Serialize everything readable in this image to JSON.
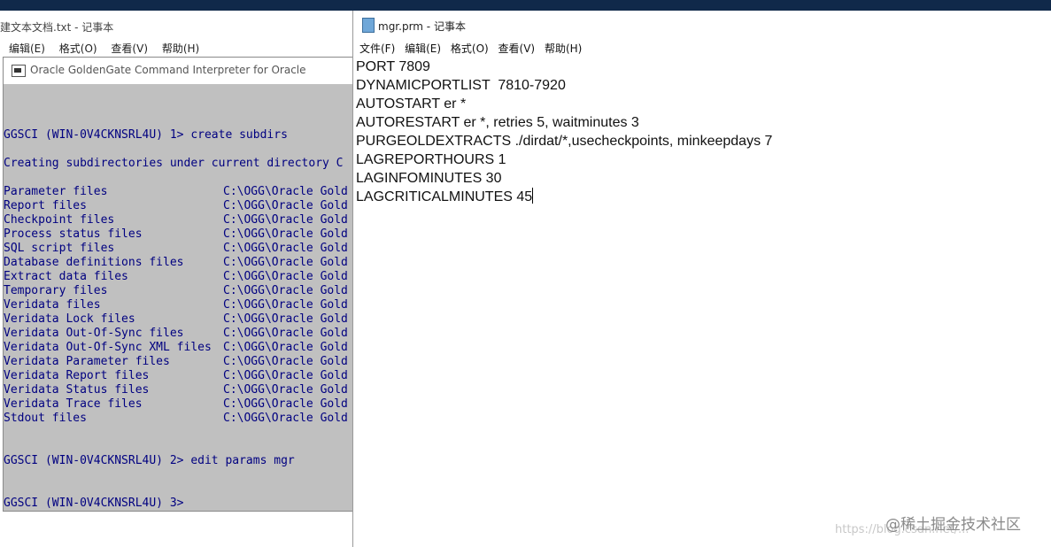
{
  "left_notepad": {
    "title": "建文本文档.txt - 记事本",
    "menu": [
      "编辑(E)",
      "格式(O)",
      "查看(V)",
      "帮助(H)"
    ]
  },
  "console": {
    "title": "Oracle GoldenGate Command Interpreter for Oracle",
    "command1": "GGSCI (WIN-0V4CKNSRL4U) 1> create subdirs",
    "creating": "Creating subdirectories under current directory C",
    "subdirs": [
      {
        "label": "Parameter files",
        "path": "C:\\OGG\\Oracle Gold"
      },
      {
        "label": "Report files",
        "path": "C:\\OGG\\Oracle Gold"
      },
      {
        "label": "Checkpoint files",
        "path": "C:\\OGG\\Oracle Gold"
      },
      {
        "label": "Process status files",
        "path": "C:\\OGG\\Oracle Gold"
      },
      {
        "label": "SQL script files",
        "path": "C:\\OGG\\Oracle Gold"
      },
      {
        "label": "Database definitions files",
        "path": "C:\\OGG\\Oracle Gold"
      },
      {
        "label": "Extract data files",
        "path": "C:\\OGG\\Oracle Gold"
      },
      {
        "label": "Temporary files",
        "path": "C:\\OGG\\Oracle Gold"
      },
      {
        "label": "Veridata files",
        "path": "C:\\OGG\\Oracle Gold"
      },
      {
        "label": "Veridata Lock files",
        "path": "C:\\OGG\\Oracle Gold"
      },
      {
        "label": "Veridata Out-Of-Sync files",
        "path": "C:\\OGG\\Oracle Gold"
      },
      {
        "label": "Veridata Out-Of-Sync XML files",
        "path": "C:\\OGG\\Oracle Gold"
      },
      {
        "label": "Veridata Parameter files",
        "path": "C:\\OGG\\Oracle Gold"
      },
      {
        "label": "Veridata Report files",
        "path": "C:\\OGG\\Oracle Gold"
      },
      {
        "label": "Veridata Status files",
        "path": "C:\\OGG\\Oracle Gold"
      },
      {
        "label": "Veridata Trace files",
        "path": "C:\\OGG\\Oracle Gold"
      },
      {
        "label": "Stdout files",
        "path": "C:\\OGG\\Oracle Gold"
      }
    ],
    "command2": "GGSCI (WIN-0V4CKNSRL4U) 2> edit params mgr",
    "prompt3": "GGSCI (WIN-0V4CKNSRL4U) 3>"
  },
  "right_notepad": {
    "title": "mgr.prm - 记事本",
    "menu": [
      "文件(F)",
      "编辑(E)",
      "格式(O)",
      "查看(V)",
      "帮助(H)"
    ],
    "lines": [
      "PORT 7809",
      "DYNAMICPORTLIST  7810-7920",
      "AUTOSTART er *",
      "AUTORESTART er *, retries 5, waitminutes 3",
      "PURGEOLDEXTRACTS ./dirdat/*,usecheckpoints, minkeepdays 7",
      "LAGREPORTHOURS 1",
      "LAGINFOMINUTES 30",
      "LAGCRITICALMINUTES 45"
    ]
  },
  "watermark": {
    "brand": "@稀土掘金技术社区",
    "url": "https://blog.csdn.net/..."
  }
}
